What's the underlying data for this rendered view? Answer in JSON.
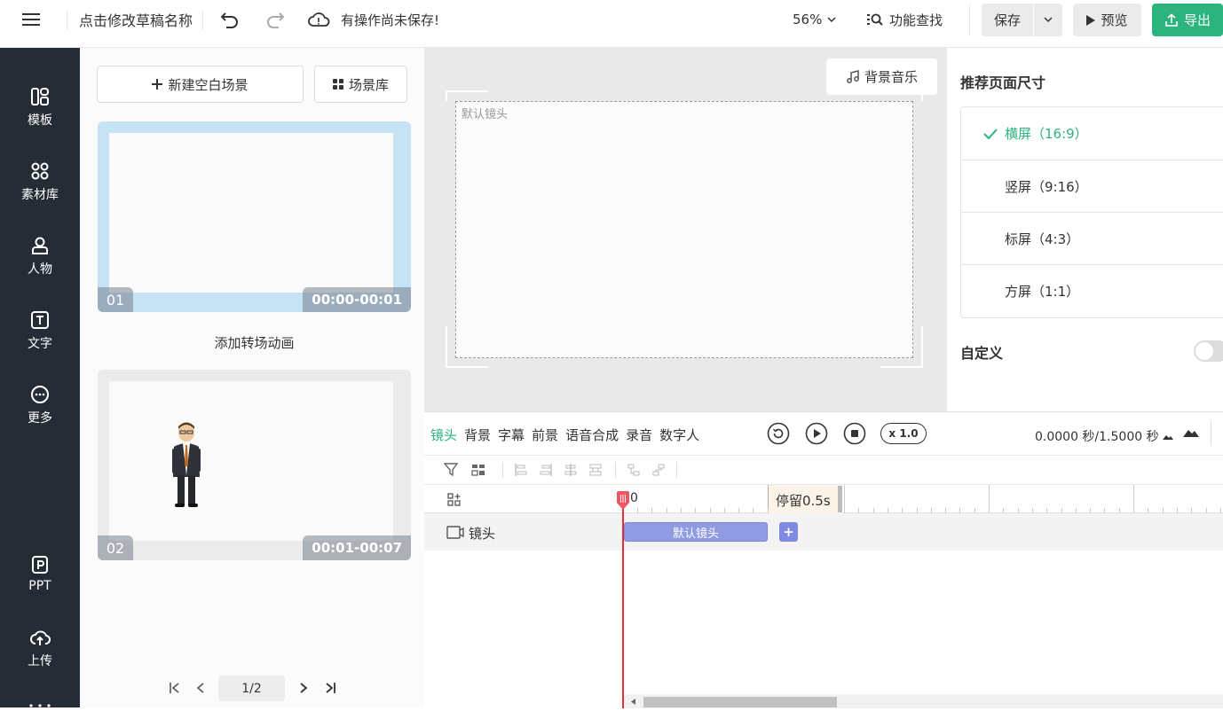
{
  "header": {
    "draft_name": "点击修改草稿名称",
    "unsaved_status": "有操作尚未保存!",
    "zoom": "56%",
    "feature_search": "功能查找",
    "save_label": "保存",
    "preview_label": "预览",
    "export_label": "导出"
  },
  "sidebar": {
    "items": [
      {
        "label": "模板",
        "icon": "template-icon"
      },
      {
        "label": "素材库",
        "icon": "material-icon"
      },
      {
        "label": "人物",
        "icon": "person-icon"
      },
      {
        "label": "文字",
        "icon": "text-icon"
      },
      {
        "label": "更多",
        "icon": "more-icon"
      },
      {
        "label": "PPT",
        "icon": "ppt-icon"
      },
      {
        "label": "上传",
        "icon": "upload-icon"
      }
    ]
  },
  "scenes": {
    "new_scene": "新建空白场景",
    "library": "场景库",
    "transition": "添加转场动画",
    "cards": [
      {
        "num": "01",
        "time": "00:00-00:01"
      },
      {
        "num": "02",
        "time": "00:01-00:07"
      }
    ],
    "page": "1/2"
  },
  "canvas": {
    "bg_music": "背景音乐",
    "default_shot": "默认镜头"
  },
  "size_panel": {
    "title": "推荐页面尺寸",
    "options": [
      {
        "label": "横屏（16:9）",
        "selected": true
      },
      {
        "label": "竖屏（9:16）",
        "selected": false
      },
      {
        "label": "标屏（4:3）",
        "selected": false
      },
      {
        "label": "方屏（1:1）",
        "selected": false
      }
    ],
    "custom": "自定义",
    "accent": "#2db37d"
  },
  "timeline": {
    "tabs": [
      "镜头",
      "背景",
      "字幕",
      "前景",
      "语音合成",
      "录音",
      "数字人"
    ],
    "speed": "x 1.0",
    "time_display": "0.0000 秒/1.5000 秒",
    "ruler_start": "0",
    "pause_label": "停留0.5s",
    "track_label": "镜头",
    "clip_label": "默认镜头",
    "add_label": "+"
  }
}
